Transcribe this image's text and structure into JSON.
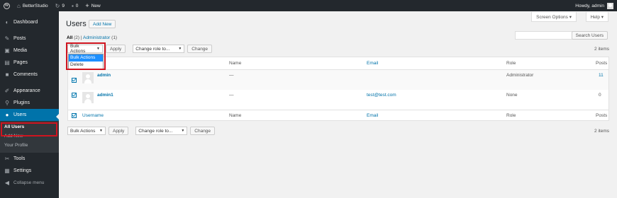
{
  "admin_bar": {
    "site_name": "BetterStudio",
    "updates_count": "9",
    "comments_count": "0",
    "new_label": "New",
    "howdy": "Howdy, admin"
  },
  "sidebar": {
    "items": [
      {
        "label": "Dashboard",
        "icon": "dashboard-icon"
      },
      {
        "label": "Posts",
        "icon": "pin-icon"
      },
      {
        "label": "Media",
        "icon": "media-icon"
      },
      {
        "label": "Pages",
        "icon": "pages-icon"
      },
      {
        "label": "Comments",
        "icon": "comments-icon"
      },
      {
        "label": "Appearance",
        "icon": "brush-icon"
      },
      {
        "label": "Plugins",
        "icon": "plugin-icon"
      },
      {
        "label": "Users",
        "icon": "users-icon"
      },
      {
        "label": "Tools",
        "icon": "wrench-icon"
      },
      {
        "label": "Settings",
        "icon": "settings-icon"
      },
      {
        "label": "Collapse menu",
        "icon": "collapse-icon"
      }
    ],
    "submenu": [
      "All Users",
      "Add New",
      "Your Profile"
    ]
  },
  "screen_options": "Screen Options ▾",
  "help": "Help ▾",
  "page": {
    "title": "Users",
    "add_new": "Add New"
  },
  "filters": {
    "all": "All",
    "all_count": "(2)",
    "separator": "|",
    "administrator": "Administrator",
    "administrator_count": "(1)"
  },
  "search": {
    "placeholder": "",
    "button": "Search Users"
  },
  "tablenav": {
    "bulk_actions": "Bulk Actions",
    "apply": "Apply",
    "change_role": "Change role to...",
    "change": "Change",
    "items_count": "2 items"
  },
  "bulk_dropdown": {
    "options": [
      "Bulk Actions",
      "Delete"
    ],
    "selected_index": 0
  },
  "table": {
    "columns": {
      "username": "Username",
      "name": "Name",
      "email": "Email",
      "role": "Role",
      "posts": "Posts"
    },
    "rows": [
      {
        "username": "admin",
        "name": "—",
        "email": "",
        "role": "Administrator",
        "posts": "11"
      },
      {
        "username": "admin1",
        "name": "—",
        "email": "test@test.com",
        "role": "None",
        "posts": "0"
      }
    ]
  },
  "colors": {
    "admin_bar": "#23282d",
    "accent": "#0073aa",
    "highlight_border": "#d0141f"
  }
}
